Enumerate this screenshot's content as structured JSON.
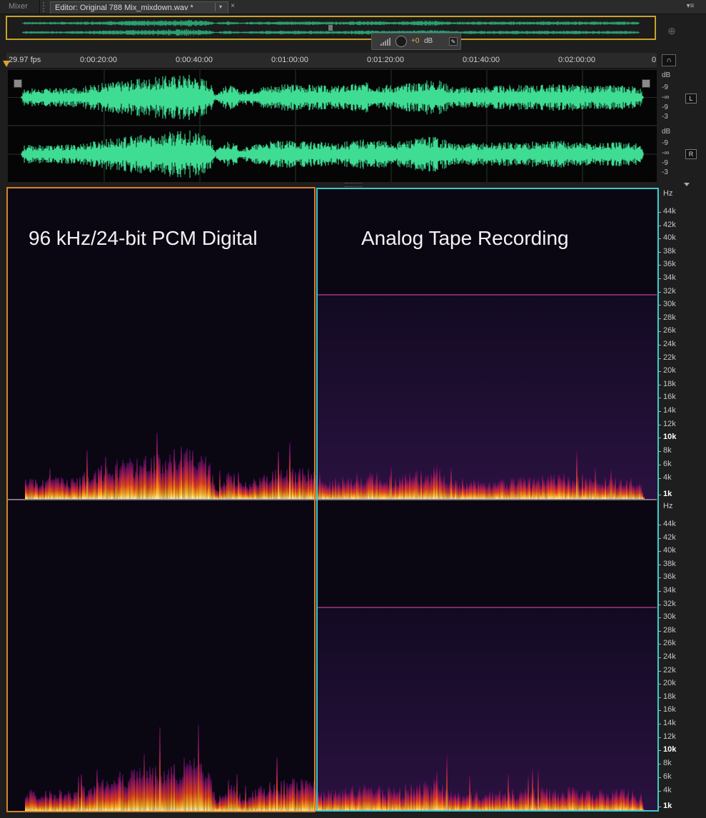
{
  "tabs": {
    "mixer": "Mixer",
    "editor": "Editor: Original 788 Mix_mixdown.wav *",
    "close": "×",
    "dropdown": "▾",
    "panel_menu": "▾≡"
  },
  "hud": {
    "value": "+0",
    "unit": "dB",
    "pin": "✎"
  },
  "ruler": {
    "fps": "29.97 fps",
    "labels": [
      "0:00:20:00",
      "0:00:40:00",
      "0:01:00:00",
      "0:01:20:00",
      "0:01:40:00",
      "0:02:00:00",
      "0"
    ]
  },
  "headphones": "∩",
  "zoom_icon": "⊕",
  "waveform": {
    "color": "#3fdc93",
    "channels": [
      {
        "name": "L",
        "db_ticks": [
          "dB",
          "-9",
          "-∞",
          "-9",
          "-3"
        ]
      },
      {
        "name": "R",
        "db_ticks": [
          "dB",
          "-9",
          "-∞",
          "-9",
          "-3"
        ]
      }
    ]
  },
  "spectral": {
    "left_label": "96 kHz/24-bit PCM Digital",
    "right_label": "Analog Tape Recording",
    "hz_unit": "Hz",
    "hz_ticks": [
      "44k",
      "42k",
      "40k",
      "38k",
      "36k",
      "34k",
      "32k",
      "30k",
      "28k",
      "26k",
      "24k",
      "22k",
      "20k",
      "18k",
      "16k",
      "14k",
      "12k",
      "10k",
      "8k",
      "6k",
      "4k",
      "1k"
    ],
    "left_border_color": "#d8812a",
    "right_border_color": "#3cc8cf"
  }
}
